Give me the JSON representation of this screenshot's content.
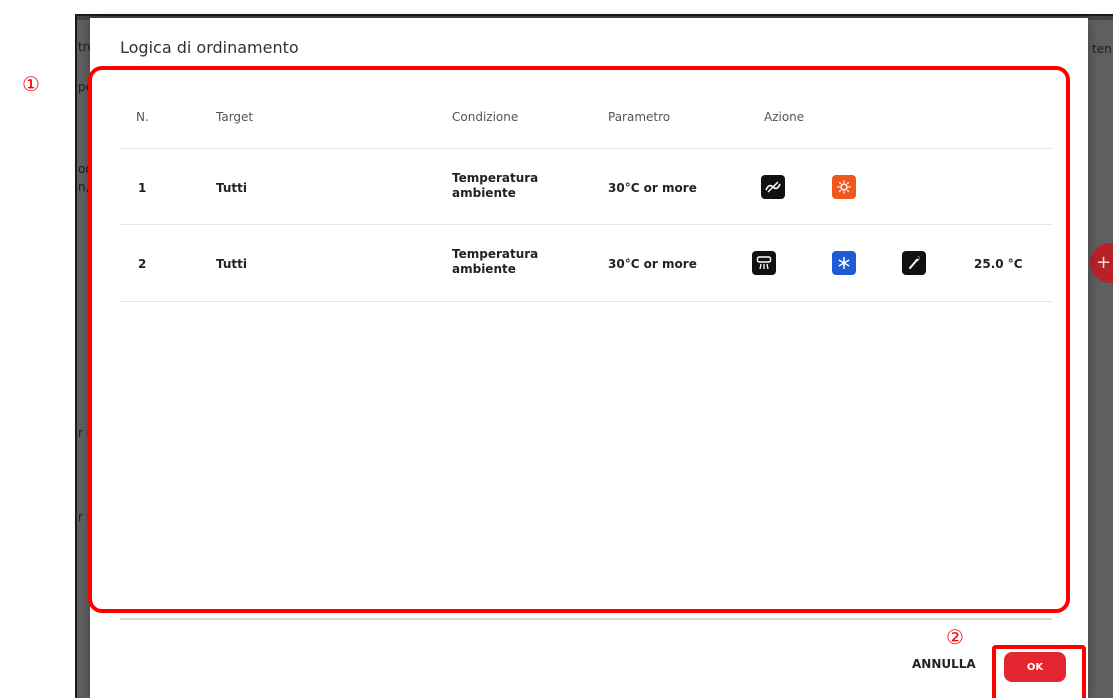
{
  "background": {
    "fragments": [
      "tro",
      "pe",
      "od",
      "n, i",
      "r u",
      "r u",
      "ten"
    ]
  },
  "dialog": {
    "title": "Logica di ordinamento",
    "columns": [
      "N.",
      "Target",
      "Condizione",
      "Parametro",
      "Azione"
    ],
    "rows": [
      {
        "n": "1",
        "target": "Tutti",
        "condition_line1": "Temperatura",
        "condition_line2": "ambiente",
        "parameter": "30°C or more",
        "actions": [
          {
            "icon": "ac-off-icon",
            "color": "#111111"
          },
          {
            "icon": "heat-mode-icon",
            "color": "#f0571d"
          }
        ]
      },
      {
        "n": "2",
        "target": "Tutti",
        "condition_line1": "Temperatura",
        "condition_line2": "ambiente",
        "parameter": "30°C or more",
        "actions": [
          {
            "icon": "ac-on-icon",
            "color": "#111111"
          },
          {
            "icon": "cool-mode-icon",
            "color": "#1f5bd4"
          },
          {
            "icon": "temperature-setpoint-icon",
            "color": "#111111"
          }
        ],
        "setpoint": "25.0 °C"
      }
    ],
    "buttons": {
      "cancel": "ANNULLA",
      "ok": "OK"
    }
  },
  "annotations": {
    "callout1": "①",
    "callout2": "②",
    "highlight_color": "#ff0000"
  }
}
